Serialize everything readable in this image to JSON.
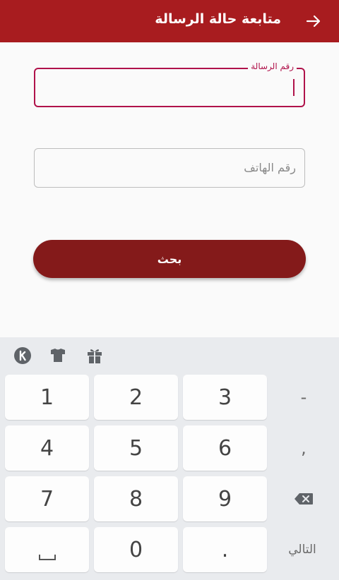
{
  "appbar": {
    "title": "متابعة حالة الرسالة",
    "background": "#a81c1f"
  },
  "form": {
    "message_field": {
      "label": "رقم الرسالة",
      "value": ""
    },
    "phone_field": {
      "placeholder": "رقم الهاتف",
      "value": ""
    },
    "search_button": {
      "label": "بحث"
    },
    "accent_color": "#b0124a",
    "button_color": "#841a1a"
  },
  "keyboard": {
    "toolbar_icons": [
      "k-logo-icon",
      "tshirt-theme-icon",
      "gift-icon"
    ],
    "keys": {
      "k1": "1",
      "k2": "2",
      "k3": "3",
      "k4": "4",
      "k5": "5",
      "k6": "6",
      "k7": "7",
      "k8": "8",
      "k9": "9",
      "k0": "0",
      "dot": ".",
      "minus": "-",
      "comma": ",",
      "next": "التالي"
    },
    "background": "#e9ebee"
  }
}
